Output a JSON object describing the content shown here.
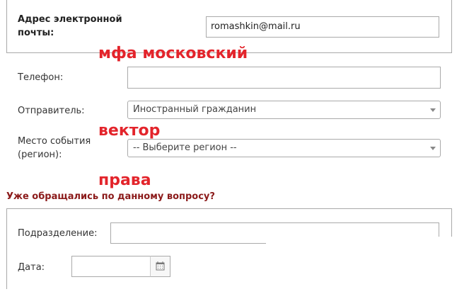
{
  "contact": {
    "email_label": "Адрес электронной почты:",
    "email_value": "romashkin@mail.ru",
    "phone_label": "Телефон:",
    "phone_value": "",
    "sender_label": "Отправитель:",
    "sender_value": "Иностранный гражданин",
    "place_label": "Место события (регион):",
    "place_value": "-- Выберите регион --"
  },
  "overlays": {
    "text1": "мфа московский",
    "text2": "вектор",
    "text3": "права"
  },
  "previous_request": {
    "question": "Уже обращались по данному вопросу?",
    "division_label": "Подразделение:",
    "division_value": "",
    "date_label": "Дата:",
    "date_value": ""
  },
  "icons": {
    "select_caret": "chevron-down-icon",
    "calendar": "calendar-icon"
  },
  "colors": {
    "overlay_text": "#e3242b",
    "question_text": "#8b1a1a",
    "border": "#a9a9a9"
  }
}
